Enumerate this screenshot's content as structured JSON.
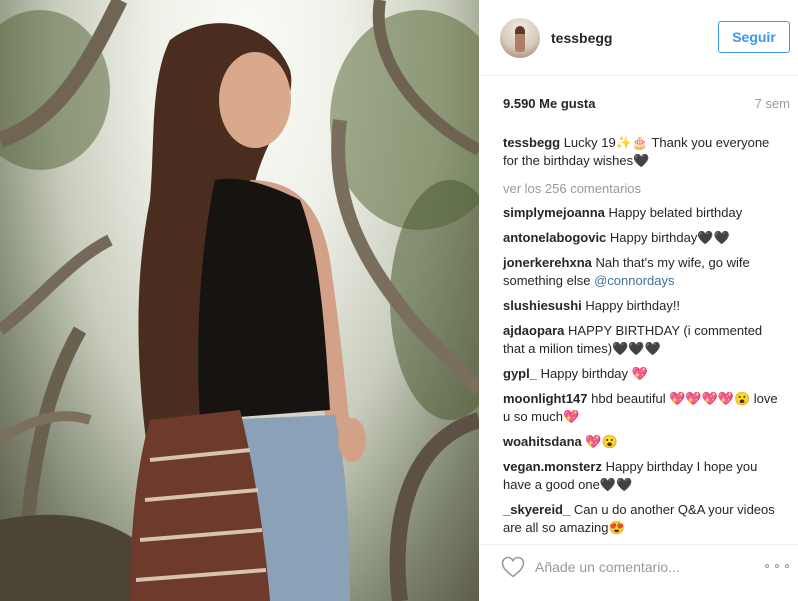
{
  "post": {
    "username": "tessbegg",
    "follow_label": "Seguir",
    "likes": "9.590 Me gusta",
    "time_ago": "7 sem"
  },
  "comments": [
    {
      "user": "tessbegg",
      "text": "Lucky 19✨🎂 Thank you everyone for the birthday wishes🖤"
    },
    {
      "user": "simplymejoanna",
      "text": "Happy belated birthday"
    },
    {
      "user": "antonelabogovic",
      "text": "Happy birthday🖤🖤"
    },
    {
      "user": "jonerkerehxna",
      "text": "Nah that's my wife, go wife something else",
      "mention": "@connordays"
    },
    {
      "user": "slushiesushi",
      "text": "Happy birthday!!"
    },
    {
      "user": "ajdaopara",
      "text": "HAPPY BIRTHDAY (i commented that a milion times)🖤🖤🖤"
    },
    {
      "user": "gypl_",
      "text": "Happy birthday 💖"
    },
    {
      "user": "moonlight147",
      "text": "hbd beautiful 💖💖💖💖😮 love u so much💖"
    },
    {
      "user": "woahitsdana",
      "text": "💖😮"
    },
    {
      "user": "vegan.monsterz",
      "text": "Happy birthday I hope you have a good one🖤🖤"
    },
    {
      "user": "_skyereid_",
      "text": "Can u do another Q&A your videos are all so amazing😍"
    }
  ],
  "view_more": "ver los 256 comentarios",
  "add_comment": {
    "placeholder": "Añade un comentario..."
  },
  "icons": {
    "like": "heart-outline-icon",
    "more": "more-options-icon"
  },
  "colors": {
    "accent": "#3897f0",
    "mention": "#3f729b",
    "muted": "#999999",
    "text": "#262626"
  }
}
